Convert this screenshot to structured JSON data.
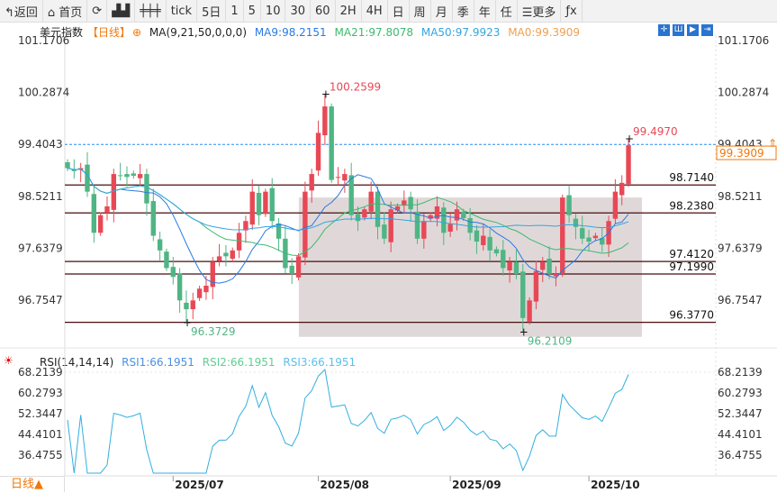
{
  "toolbar": {
    "items": [
      {
        "label": "↰返回",
        "icon": "back-icon"
      },
      {
        "label": "⌂ 首页",
        "icon": "home-icon"
      },
      {
        "label": "⟳",
        "icon": "refresh-icon"
      },
      {
        "label": "▟▟",
        "icon": "chart-bars-icon"
      },
      {
        "label": "╪╪╪",
        "icon": "candles-icon"
      },
      {
        "label": "tick"
      },
      {
        "label": "5日"
      },
      {
        "label": "1"
      },
      {
        "label": "5"
      },
      {
        "label": "10"
      },
      {
        "label": "30"
      },
      {
        "label": "60"
      },
      {
        "label": "2H"
      },
      {
        "label": "4H"
      },
      {
        "label": "日"
      },
      {
        "label": "周"
      },
      {
        "label": "月"
      },
      {
        "label": "季"
      },
      {
        "label": "年"
      },
      {
        "label": "任"
      },
      {
        "label": "☰更多",
        "icon": "menu-icon"
      },
      {
        "label": "ƒx",
        "icon": "formula-icon"
      }
    ]
  },
  "legend": {
    "title": "美元指数",
    "period": "【日线】",
    "ma_label": "MA(9,21,50,0,0,0)",
    "ma9": "MA9:98.2151",
    "ma21": "MA21:97.8078",
    "ma50": "MA50:97.9923",
    "ma0": "MA0:99.3909"
  },
  "rsi_legend": {
    "title": "RSI(14,14,14)",
    "rsi1": "RSI1:66.1951",
    "rsi2": "RSI2:66.1951",
    "rsi3": "RSI3:66.1951"
  },
  "period_button": "日线▲",
  "colors": {
    "up": "#e84856",
    "down": "#4fb584",
    "ma9": "#2a7ae2",
    "ma21": "#3cba6f",
    "ma50": "#33a5e0",
    "last": "#f0780a",
    "rsi": "#33aee0"
  },
  "chart_data": {
    "type": "candlestick",
    "price_axis": [
      "101.1706",
      "100.2874",
      "99.4043",
      "98.5211",
      "97.6379",
      "96.7547"
    ],
    "last_price": "99.3909",
    "closes": [
      99.0,
      98.95,
      99.0,
      98.6,
      97.9,
      98.2,
      98.35,
      98.9,
      98.88,
      98.85,
      98.87,
      98.9,
      98.4,
      97.85,
      97.6,
      97.3,
      97.15,
      96.75,
      96.6,
      96.75,
      96.95,
      97.0,
      97.4,
      97.5,
      97.5,
      97.6,
      97.9,
      98.1,
      98.6,
      98.2,
      98.6,
      98.1,
      97.8,
      97.3,
      97.2,
      97.5,
      98.6,
      98.9,
      99.6,
      100.05,
      98.8,
      98.85,
      98.9,
      98.2,
      98.1,
      98.3,
      98.6,
      98.0,
      97.8,
      98.3,
      98.35,
      98.45,
      98.3,
      97.8,
      98.1,
      98.2,
      98.35,
      97.9,
      98.05,
      98.3,
      98.15,
      97.9,
      97.75,
      97.85,
      97.6,
      97.55,
      97.3,
      97.4,
      97.2,
      96.45,
      96.75,
      97.25,
      97.4,
      97.2,
      97.2,
      98.5,
      98.2,
      98.0,
      97.8,
      97.75,
      97.85,
      97.7,
      98.1,
      98.6,
      98.75,
      99.39
    ],
    "annotations": [
      {
        "label": "100.2599",
        "index": 39,
        "value": 100.2599,
        "kind": "high"
      },
      {
        "label": "96.3729",
        "index": 18,
        "value": 96.3729,
        "kind": "low"
      },
      {
        "label": "96.2109",
        "index": 69,
        "value": 96.2109,
        "kind": "low"
      },
      {
        "label": "99.4970",
        "index": 85,
        "value": 99.497,
        "kind": "high"
      }
    ],
    "levels": [
      {
        "label": "98.7140",
        "value": 98.714
      },
      {
        "label": "98.2380",
        "value": 98.238
      },
      {
        "label": "97.4120",
        "value": 97.412
      },
      {
        "label": "97.1990",
        "value": 97.199
      },
      {
        "label": "96.3770",
        "value": 96.377
      }
    ],
    "range_box": {
      "from_index": 36,
      "to_index": 88,
      "top": 98.5,
      "bottom": 96.13
    },
    "rsi_axis": [
      "68.2139",
      "60.2793",
      "52.3447",
      "44.4101",
      "36.4755"
    ],
    "dates": [
      {
        "label": "2025/07",
        "index": 16
      },
      {
        "label": "2025/08",
        "index": 38
      },
      {
        "label": "2025/09",
        "index": 58
      },
      {
        "label": "2025/10",
        "index": 79
      }
    ]
  }
}
